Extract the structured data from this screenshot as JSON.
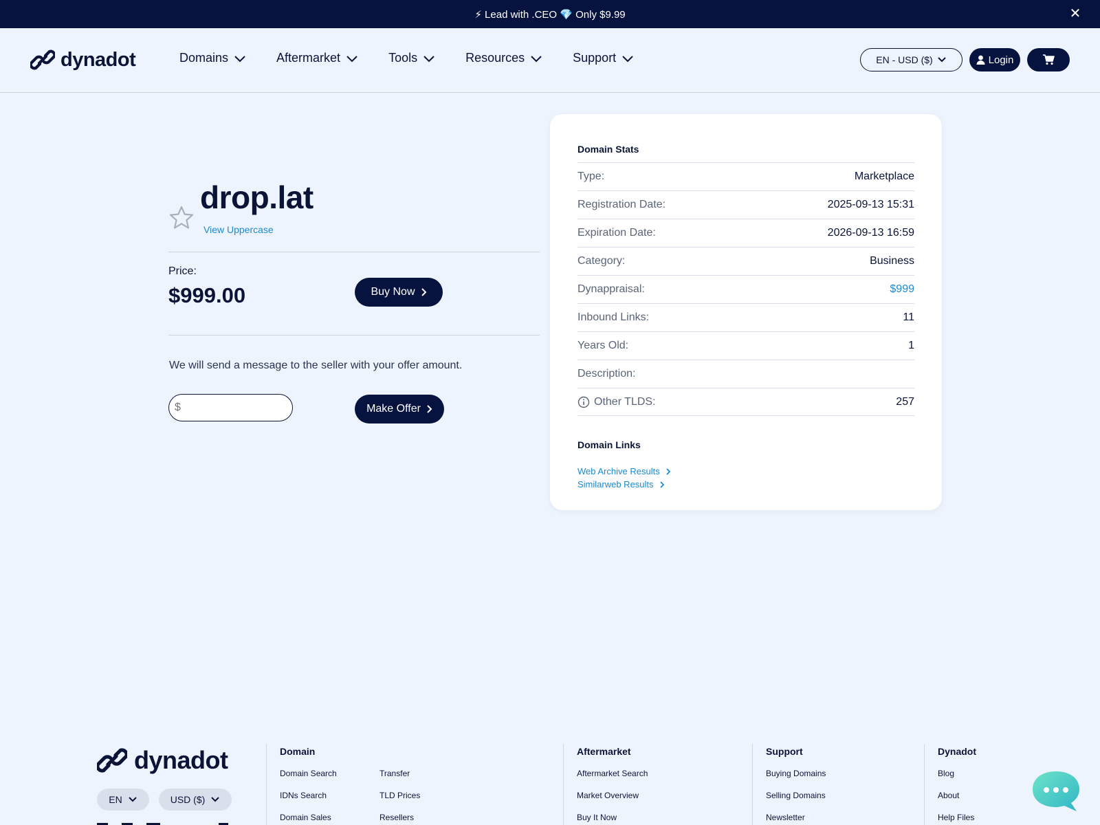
{
  "promo": {
    "text": "⚡ Lead with .CEO 💎 Only $9.99",
    "close_label": "✕"
  },
  "header": {
    "logo_text": "dynadot",
    "nav": [
      {
        "label": "Domains"
      },
      {
        "label": "Aftermarket"
      },
      {
        "label": "Tools"
      },
      {
        "label": "Resources"
      },
      {
        "label": "Support"
      }
    ],
    "lang_currency": "EN - USD ($)",
    "login_label": "Login"
  },
  "domain": {
    "name": "drop.lat",
    "view_uppercase": "View Uppercase",
    "price_label": "Price:",
    "price_value": "$999.00",
    "buy_label": "Buy Now",
    "offer_message": "We will send a message to the seller with your offer amount.",
    "offer_placeholder": "$",
    "offer_label": "Make Offer"
  },
  "stats": {
    "title": "Domain Stats",
    "rows": [
      {
        "label": "Type:",
        "value": "Marketplace"
      },
      {
        "label": "Registration Date:",
        "value": "2025-09-13 15:31"
      },
      {
        "label": "Expiration Date:",
        "value": "2026-09-13 16:59"
      },
      {
        "label": "Category:",
        "value": "Business"
      },
      {
        "label": "Dynappraisal:",
        "value": "$999"
      },
      {
        "label": "Inbound Links:",
        "value": "11"
      },
      {
        "label": "Years Old:",
        "value": "1"
      },
      {
        "label": "Description:",
        "value": ""
      },
      {
        "label": "Other TLDS:",
        "value": "257"
      }
    ],
    "links_title": "Domain Links",
    "links": [
      {
        "label": "Web Archive Results"
      },
      {
        "label": "Similarweb Results"
      }
    ]
  },
  "footer": {
    "logo_text": "dynadot",
    "lang": "EN",
    "currency": "USD ($)",
    "columns": {
      "domain": {
        "title": "Domain",
        "links_a": [
          "Domain Search",
          "IDNs Search",
          "Domain Sales"
        ],
        "links_b": [
          "Transfer",
          "TLD Prices",
          "Resellers"
        ]
      },
      "aftermarket": {
        "title": "Aftermarket",
        "links": [
          "Aftermarket Search",
          "Market Overview",
          "Buy It Now"
        ]
      },
      "support": {
        "title": "Support",
        "links": [
          "Buying Domains",
          "Selling Domains",
          "Newsletter"
        ]
      },
      "dynadot": {
        "title": "Dynadot",
        "links": [
          "Blog",
          "About",
          "Help Files"
        ]
      }
    }
  },
  "colors": {
    "navy": "#07133f",
    "accent_link": "#1a8ad4",
    "background": "#eef4fd",
    "chat": "#4fd0c0"
  }
}
